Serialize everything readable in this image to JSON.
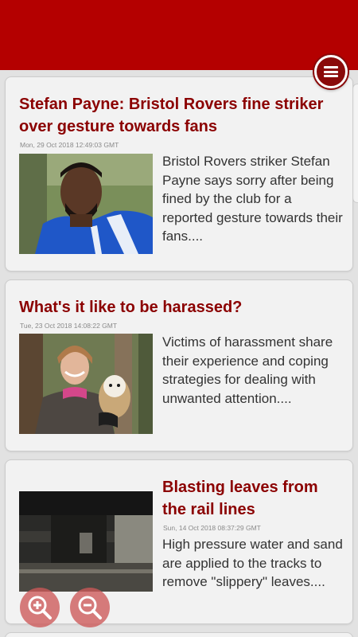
{
  "app": {
    "accent_color": "#b40000",
    "headline_color": "#8b0000",
    "menu_icon": "hamburger-menu-icon"
  },
  "articles": [
    {
      "title": "Stefan Payne: Bristol Rovers fine striker over gesture towards fans",
      "date": "Mon, 29 Oct 2018 12:49:03 GMT",
      "summary": "Bristol Rovers striker Stefan Payne says sorry after being fined by the club for a reported gesture towards their fans....",
      "image": "footballer-portrait"
    },
    {
      "title": "What's it like to be harassed?",
      "date": "Tue, 23 Oct 2018 14:08:22 GMT",
      "summary": "Victims of harassment share their experience and coping strategies for dealing with unwanted attention....",
      "image": "woman-with-owl"
    },
    {
      "title": "Blasting leaves from the rail lines",
      "date": "Sun, 14 Oct 2018 08:37:29 GMT",
      "summary": "High pressure water and sand are applied to the tracks to remove \"slippery\" leaves....",
      "image": "train-wheel"
    }
  ],
  "controls": {
    "zoom_in_icon": "zoom-in-icon",
    "zoom_out_icon": "zoom-out-icon"
  }
}
